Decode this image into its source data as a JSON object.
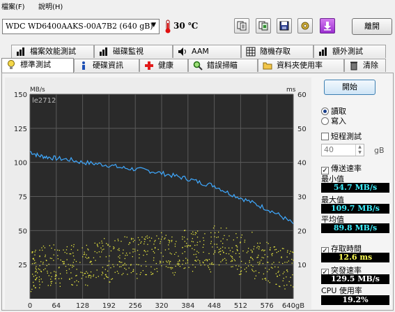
{
  "menu": {
    "file": "檔案(F)",
    "help": "說明(H)"
  },
  "drive": {
    "selected": "WDC WD6400AAKS-00A7B2 (640 gB)",
    "temperature": "30 ℃"
  },
  "toolbar": {
    "icons": [
      "copy-text-icon",
      "copy-screenshot-icon",
      "save-icon",
      "options-icon",
      "download-icon"
    ],
    "exit_label": "離開"
  },
  "tabs_top": [
    "檔案效能測試",
    "磁碟監視",
    "AAM",
    "隨機存取",
    "額外測試"
  ],
  "tabs_bottom": [
    "標準測試",
    "硬碟資訊",
    "健康",
    "錯誤掃瞄",
    "資料夾使用率",
    "清除"
  ],
  "sidebar": {
    "start_label": "開始",
    "read_label": "讀取",
    "write_label": "寫入",
    "mode": "read",
    "short_test_label": "短程測試",
    "short_test_checked": false,
    "short_test_size": "40",
    "short_test_unit": "gB",
    "transfer_rate_label": "傳送速率",
    "transfer_rate_checked": true,
    "min_label": "最小值",
    "min_value": "54.7 MB/s",
    "max_label": "最大值",
    "max_value": "109.7 MB/s",
    "avg_label": "平均值",
    "avg_value": "89.8 MB/s",
    "access_time_label": "存取時間",
    "access_time_checked": true,
    "access_time_value": "12.6 ms",
    "burst_label": "突發速率",
    "burst_checked": true,
    "burst_value": "129.5 MB/s",
    "cpu_label": "CPU 使用率",
    "cpu_value": "19.2%"
  },
  "chart_data": {
    "type": "line",
    "watermark": "le2712",
    "ylabel_left": "MB/s",
    "ylabel_right": "ms",
    "ylim_left": [
      0,
      150
    ],
    "ylim_right": [
      0,
      60
    ],
    "xlim": [
      0,
      640
    ],
    "x_ticks": [
      "0",
      "64",
      "128",
      "192",
      "256",
      "320",
      "384",
      "448",
      "512",
      "576",
      "640gB"
    ],
    "y_ticks_left": [
      "25",
      "50",
      "75",
      "100",
      "125",
      "150"
    ],
    "y_ticks_right": [
      "10",
      "20",
      "30",
      "40",
      "50",
      "60"
    ],
    "grid": true,
    "colors": {
      "transfer": "#3fa9ff",
      "access": "#eded40",
      "plot_bg": "#2a2a2a"
    },
    "series": [
      {
        "role": "transfer-rate",
        "x": [
          0,
          20,
          40,
          64,
          96,
          128,
          160,
          192,
          224,
          256,
          288,
          320,
          352,
          384,
          416,
          448,
          480,
          512,
          544,
          576,
          608,
          640
        ],
        "values": [
          108,
          105,
          104,
          103,
          102,
          100,
          99,
          98,
          96,
          95,
          94,
          92,
          90,
          88,
          85,
          83,
          78,
          74,
          70,
          66,
          61,
          55
        ]
      },
      {
        "role": "access-time-ms",
        "kind": "scatter",
        "x": [
          5,
          15,
          30,
          50,
          70,
          90,
          110,
          130,
          150,
          170,
          190,
          210,
          230,
          250,
          270,
          290,
          310,
          330,
          350,
          370,
          390,
          410,
          430,
          450,
          470,
          490,
          510,
          530,
          550,
          570,
          590,
          610,
          630
        ],
        "values": [
          8,
          9,
          10,
          10,
          9,
          11,
          10,
          10,
          11,
          12,
          11,
          12,
          13,
          12,
          13,
          13,
          14,
          14,
          13,
          15,
          14,
          15,
          14,
          16,
          15,
          14,
          13,
          14,
          12,
          11,
          10,
          9,
          9
        ]
      }
    ]
  }
}
